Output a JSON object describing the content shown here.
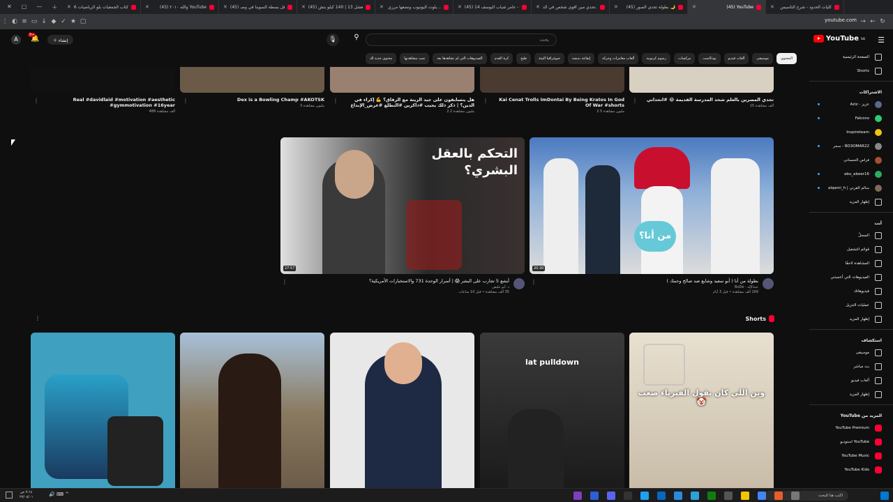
{
  "browser": {
    "tabs": [
      {
        "title": "كليات الحدود - شرح التأسيس",
        "active": false
      },
      {
        "title": "(45) YouTube",
        "active": true
      },
      {
        "title": "(45) بطولة تحدي الصور 🌙",
        "active": false
      },
      {
        "title": "تحدي مين أقوى شخص في الد...",
        "active": false
      },
      {
        "title": "(45) عامر شباب اليوسف 14 - e",
        "active": false
      },
      {
        "title": "بلوت اليوتيوب ونضعها مرزي...",
        "active": false
      },
      {
        "title": "(45) شعشل 13 | 140 كيلو بتش...",
        "active": false
      },
      {
        "title": "(45) هل بسطة السوينا في وصـ...",
        "active": false
      },
      {
        "title": "(45) واللّه ٢٠١٠ YouTube",
        "active": false
      },
      {
        "title": "كتاب الجمعيات بلو الرياضيات 6:",
        "active": false
      }
    ],
    "url": "youtube.com"
  },
  "header": {
    "logo": "YouTube",
    "logo_sup": "SA",
    "search_placeholder": "بحث",
    "create_label": "إنشاء",
    "notif_count": "9+",
    "avatar_letter": "A"
  },
  "chips": [
    {
      "label": "المحتوى",
      "active": true
    },
    {
      "label": "موسيقى",
      "active": false
    },
    {
      "label": "ألعاب فيديو",
      "active": false
    },
    {
      "label": "بودكاست",
      "active": false
    },
    {
      "label": "مزكسات",
      "active": false
    },
    {
      "label": "رسوم كرتونية",
      "active": false
    },
    {
      "label": "ألعاب مغامرات وحركة",
      "active": false
    },
    {
      "label": "إيقاعة بديعية",
      "active": false
    },
    {
      "label": "جيوغرافيا البيئة",
      "active": false
    },
    {
      "label": "طبخ",
      "active": false
    },
    {
      "label": "كرة القدم",
      "active": false
    },
    {
      "label": "الفيديوهات التي لم تشاهدها بعد",
      "active": false
    },
    {
      "label": "تمت مشاهدتها",
      "active": false
    },
    {
      "label": "محتوى جديد لك",
      "active": false
    }
  ],
  "sidebar": {
    "main": [
      {
        "label": "الصفحة الرئيسية",
        "icon": "home-icon"
      },
      {
        "label": "Shorts",
        "icon": "shorts-icon"
      }
    ],
    "subs_title": "الاشتراكات",
    "subs": [
      {
        "label": "عزيز - Aziz",
        "dot": true,
        "color": "#5a6a8a"
      },
      {
        "label": "Falcons",
        "dot": true,
        "color": "#2ecc71"
      },
      {
        "label": "Inspireteam",
        "dot": false,
        "color": "#f1c40f"
      },
      {
        "label": "BO3OMAR22 - سحر",
        "dot": true,
        "color": "#888888"
      },
      {
        "label": "فراس الحسناني",
        "dot": false,
        "color": "#a0522d"
      },
      {
        "label": "abu_abeer16",
        "dot": true,
        "color": "#27ae60"
      },
      {
        "label": "سالم القرني | alqarni_h",
        "dot": true,
        "color": "#7f6a5a"
      }
    ],
    "subs_more": "إظهار المزيد",
    "you_title": "أنت",
    "you": [
      {
        "label": "السجلّ",
        "icon": "history-icon"
      },
      {
        "label": "قوائم التشغيل",
        "icon": "playlists-icon"
      },
      {
        "label": "المشاهدة لاحقًا",
        "icon": "watch-later-icon"
      },
      {
        "label": "الفيديوهات التي أعجبتني",
        "icon": "like-icon"
      },
      {
        "label": "فيديوهاتك",
        "icon": "your-videos-icon"
      },
      {
        "label": "عمليات التنزيل",
        "icon": "download-icon"
      },
      {
        "label": "إظهار المزيد",
        "icon": "chevron-down-icon"
      }
    ],
    "explore_title": "استكشاف",
    "explore": [
      {
        "label": "موسيقى",
        "icon": "music-icon"
      },
      {
        "label": "بث مباشر",
        "icon": "live-icon"
      },
      {
        "label": "ألعاب فيديو",
        "icon": "gaming-icon"
      },
      {
        "label": "إظهار المزيد",
        "icon": "chevron-down-icon"
      }
    ],
    "more_title": "المزيد من YouTube",
    "more": [
      {
        "label": "YouTube Premium"
      },
      {
        "label": "YouTube استوديو"
      },
      {
        "label": "YouTube Music"
      },
      {
        "label": "YouTube Kids"
      }
    ]
  },
  "top_row": [
    {
      "title": "Real #davidlaid #motivation #aesthetic #gymmotivation #16year",
      "meta": "488 ألف مشاهدة",
      "color": "#111111"
    },
    {
      "title": "Dex is a Bowling Champ #AKOTSK",
      "meta": "3 مليون مشاهدة",
      "color": "#6b5a48"
    },
    {
      "title": "هل يتسابقون على جيد الزينة مع الرفاق؟ 💪 إكراء في الدين؟ | ذكر ذلك يجيب #ذاكرين #التطلع #عرض_الإبداع",
      "meta": "2.2 مليون مشاهدة",
      "color": "#9a8070"
    },
    {
      "title": "Kai Cenat Trolls ImDontai By Being Kratos In God Of War #shorts",
      "meta": "2.5 مليون مشاهدة",
      "color": "#4a3a30"
    },
    {
      "title": "تحدي المصرين بالعلم شحد المدرسة القديمة 😂 #اتحداني",
      "meta": "15 ألف مشاهدة",
      "color": "#d8d0c0"
    }
  ],
  "featured": [
    {
      "title": "بطولة من أنا ( أبو سعيد وشايع ضد صالح وحمك )",
      "channel": "عبدالإله - BoDe",
      "meta": "169 ألف مشاهدة • قبل 3 أيام",
      "duration": "20:30",
      "thumb_text": "من أنا؟",
      "color": "#3a6aa8"
    },
    {
      "title": "أبشع 5 تجارب على البشر 😱 | أسرار الوحدة 731 والاستخبارات الأمريكية؟",
      "channel": "د. أبو عليص",
      "meta": "35 ألف مشاهدة • قبل 10 ساعات",
      "duration": "27:57",
      "thumb_text": "التحكم بالعقل البشري؟",
      "color": "#2a2a2a"
    }
  ],
  "shorts_title": "Shorts",
  "shorts": [
    {
      "caption": "",
      "color": "#3fa0c0"
    },
    {
      "caption": "",
      "color": "#7a6a5a"
    },
    {
      "caption": "",
      "color": "#e8e8e8"
    },
    {
      "caption": "lat pulldown",
      "color": "#5a5a5a"
    },
    {
      "caption": "وين اللي كان يقول الفيزياء صعب🤡",
      "color": "#d8cfc0"
    }
  ],
  "taskbar": {
    "search_placeholder": "اكتب هنا للبحث",
    "time": "٧:١٤ ص",
    "date": "٢٧/٠٨/٠١"
  }
}
